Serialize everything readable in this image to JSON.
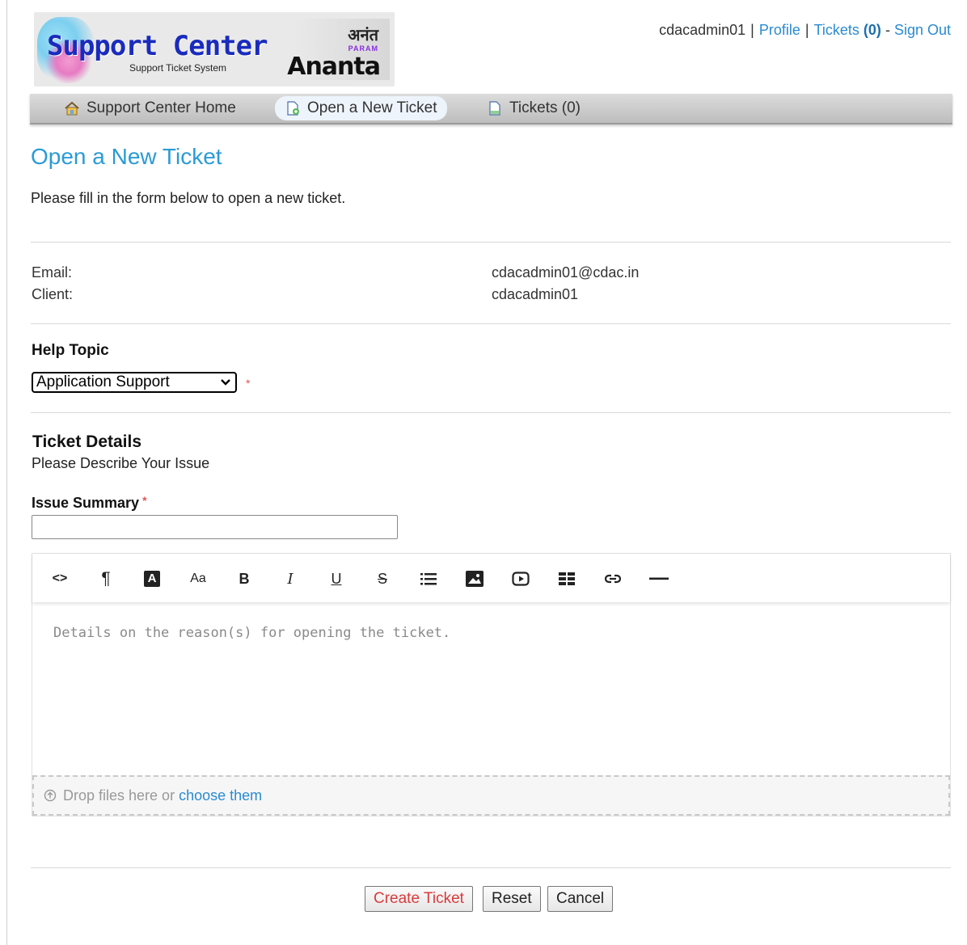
{
  "logo": {
    "brand": "Support Center",
    "subtitle": "Support Ticket System",
    "partner_top": "अनंत",
    "partner_mid": "PARAM",
    "partner_main": "Ananta"
  },
  "user_nav": {
    "username": "cdacadmin01",
    "profile": "Profile",
    "tickets_label": "Tickets",
    "tickets_count": "(0)",
    "dash": "-",
    "sign_out": "Sign Out"
  },
  "nav": {
    "home": "Support Center Home",
    "open": "Open a New Ticket",
    "tickets": "Tickets (0)"
  },
  "page": {
    "title": "Open a New Ticket",
    "intro": "Please fill in the form below to open a new ticket."
  },
  "client_info": {
    "email_label": "Email:",
    "email_value": "cdacadmin01@cdac.in",
    "client_label": "Client:",
    "client_value": "cdacadmin01"
  },
  "help_topic": {
    "label": "Help Topic",
    "selected": "Application Support",
    "required_mark": "*"
  },
  "ticket_details": {
    "heading": "Ticket Details",
    "subheading": "Please Describe Your Issue",
    "summary_label": "Issue Summary",
    "required_mark": "*",
    "summary_value": ""
  },
  "editor": {
    "placeholder": "Details on the reason(s) for opening the ticket.",
    "toolbar": {
      "code": "<>",
      "paragraph": "¶",
      "font_color": "A",
      "font_size": "Aa",
      "bold": "B",
      "italic": "I",
      "underline": "U",
      "strike": "S"
    },
    "drop_text": "Drop files here or",
    "drop_link": "choose them"
  },
  "buttons": {
    "create": "Create Ticket",
    "reset": "Reset",
    "cancel": "Cancel"
  },
  "colors": {
    "accent": "#2a9bd6",
    "link": "#2a8bd0",
    "required": "#e25353",
    "create_text": "#d93b3b"
  }
}
